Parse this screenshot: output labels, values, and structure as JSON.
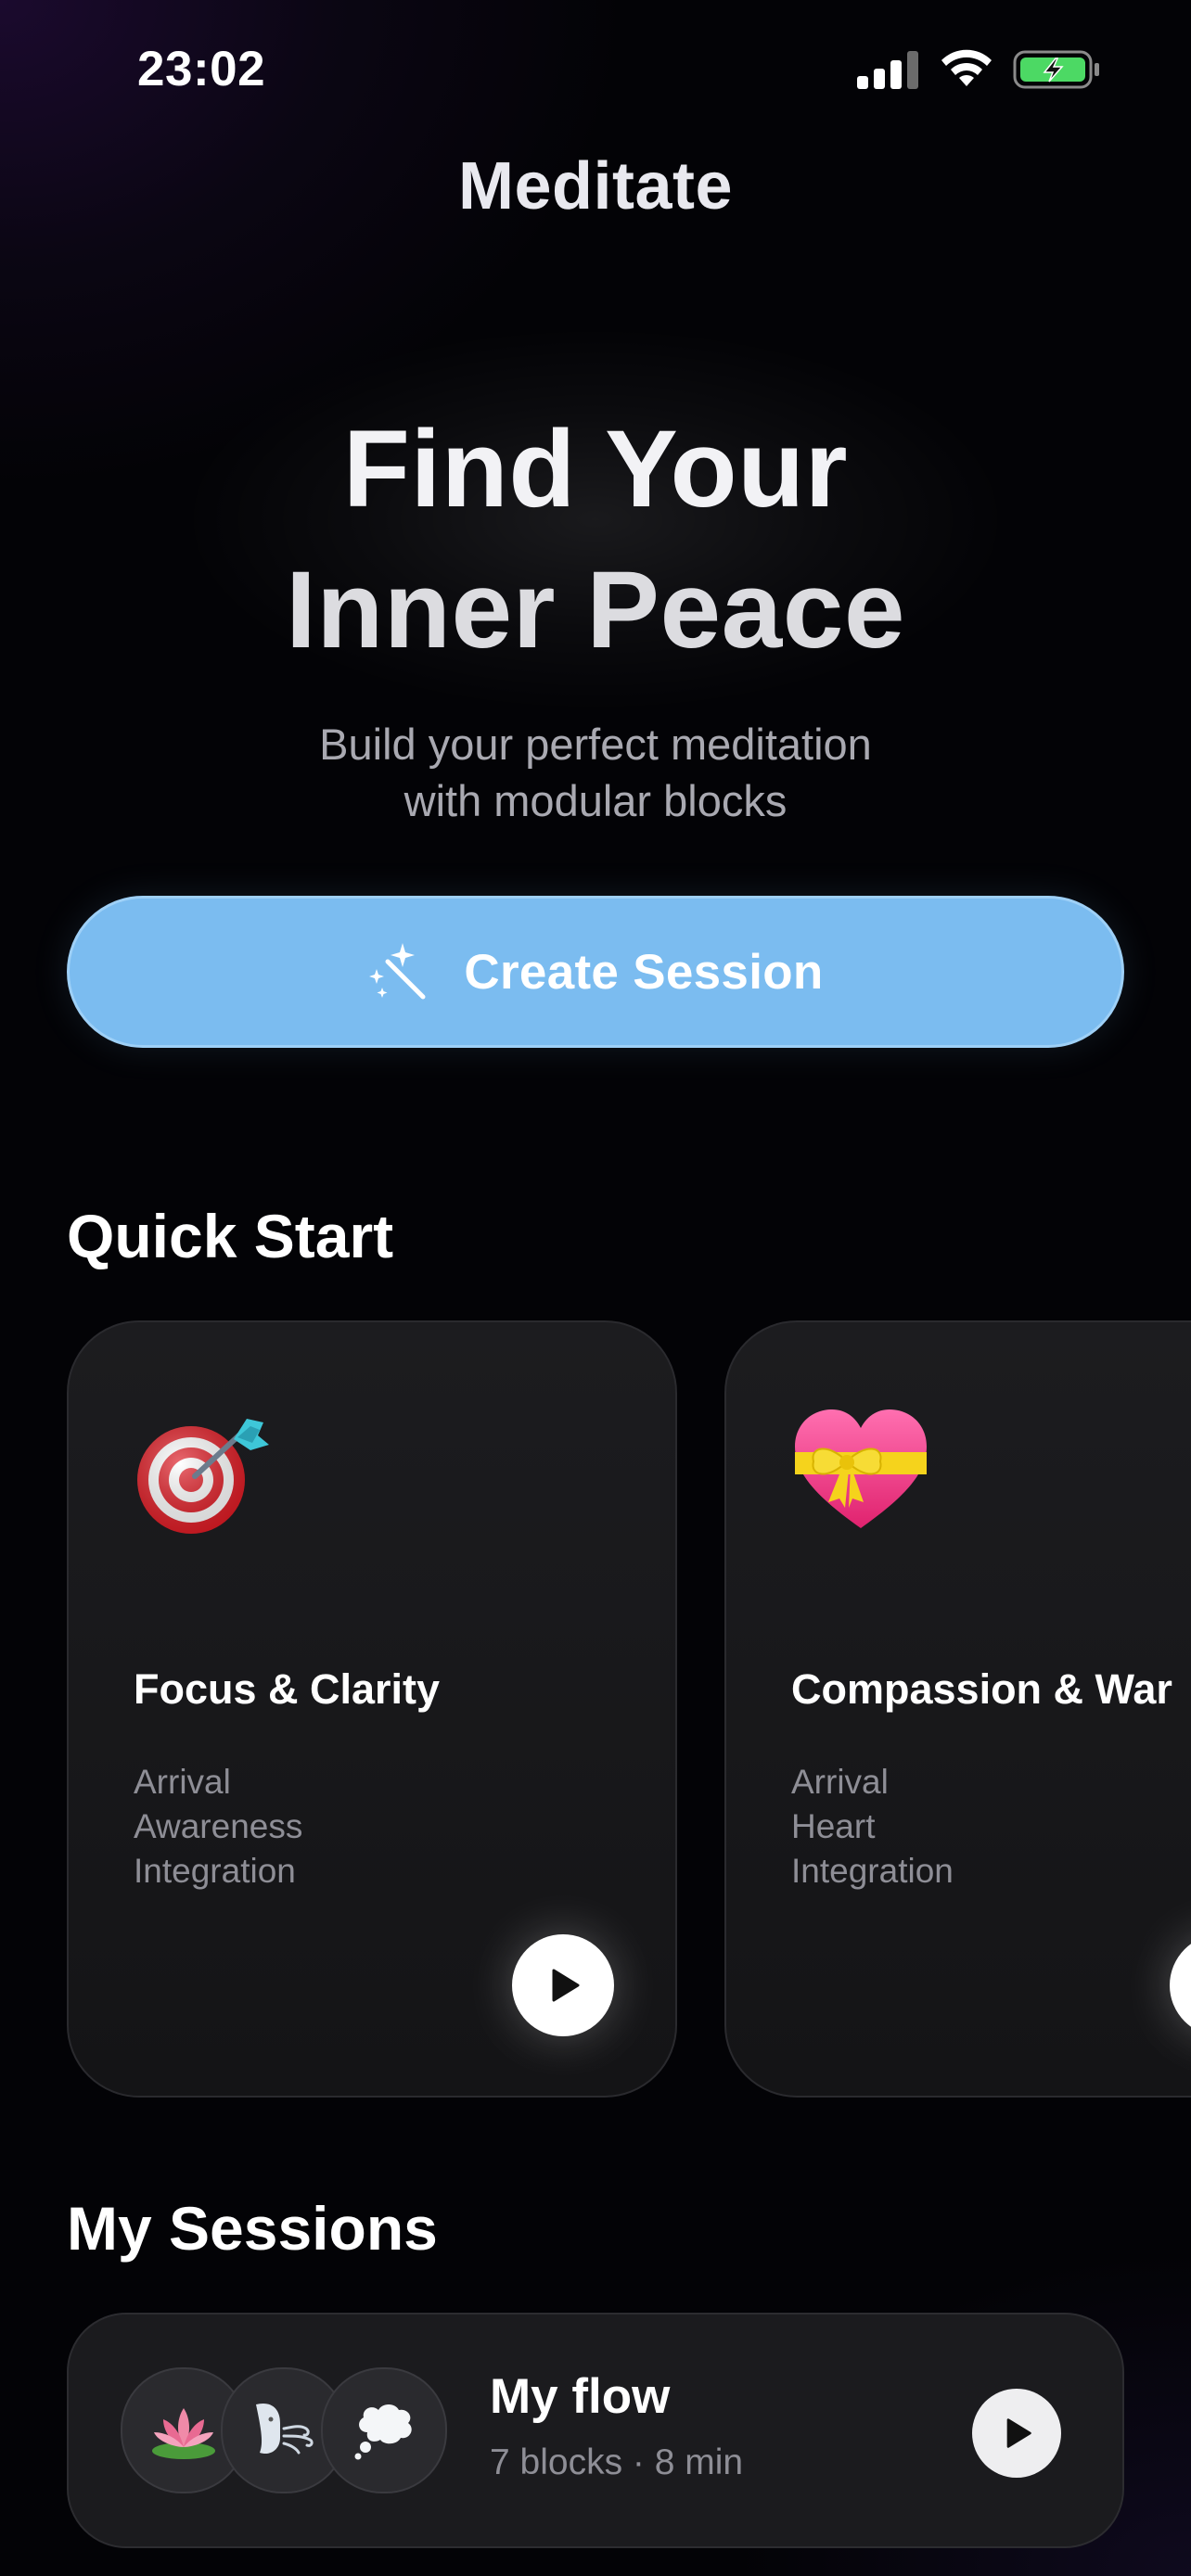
{
  "status_bar": {
    "time": "23:02",
    "icons": [
      "cellular-signal-icon",
      "wifi-icon",
      "battery-charging-icon"
    ]
  },
  "header": {
    "title": "Meditate"
  },
  "hero": {
    "title_line1": "Find Your",
    "title_line2": "Inner Peace",
    "subtitle_line1": "Build your perfect meditation",
    "subtitle_line2": "with modular blocks"
  },
  "create_button": {
    "label": "Create Session",
    "icon": "magic-wand-icon"
  },
  "quick_start": {
    "title": "Quick Start",
    "cards": [
      {
        "emoji": "direct-hit-icon",
        "title": "Focus & Clarity",
        "blocks": [
          "Arrival",
          "Awareness",
          "Integration"
        ]
      },
      {
        "emoji": "heart-with-ribbon-icon",
        "title": "Compassion & War",
        "blocks": [
          "Arrival",
          "Heart",
          "Integration"
        ]
      }
    ]
  },
  "my_sessions": {
    "title": "My Sessions",
    "items": [
      {
        "name": "My flow",
        "meta": "7 blocks · 8 min",
        "block_icons": [
          "lotus-icon",
          "wind-face-icon",
          "thought-balloon-icon"
        ]
      }
    ]
  },
  "colors": {
    "accent": "#7bbcf0",
    "background": "#030306",
    "card": "#1c1c1f",
    "muted_text": "#8e8e96"
  }
}
